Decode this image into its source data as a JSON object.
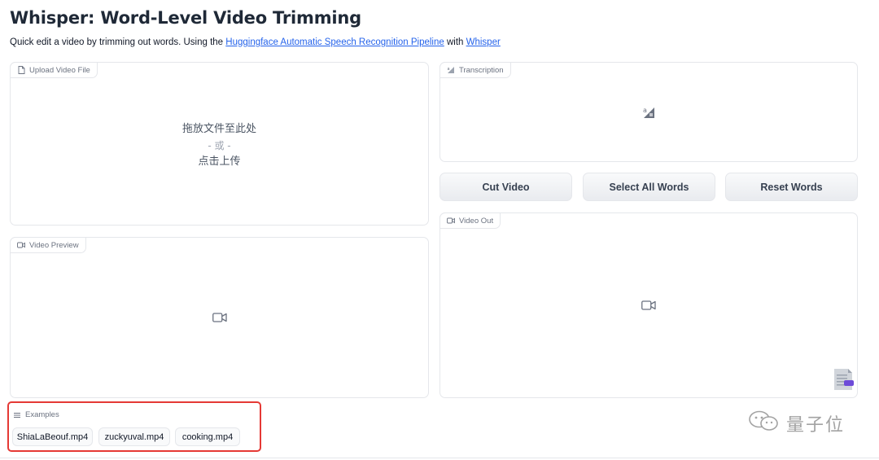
{
  "page": {
    "title": "Whisper: Word-Level Video Trimming",
    "description_prefix": "Quick edit a video by trimming out words. Using the ",
    "link_pipeline": "Huggingface Automatic Speech Recognition Pipeline",
    "description_mid": " with ",
    "link_whisper": "Whisper"
  },
  "upload": {
    "label": "Upload Video File",
    "drop_text": "拖放文件至此处",
    "or_text": "- 或 -",
    "click_text": "点击上传"
  },
  "transcription": {
    "label": "Transcription"
  },
  "buttons": {
    "cut": "Cut Video",
    "select_all": "Select All Words",
    "reset": "Reset Words"
  },
  "video_preview": {
    "label": "Video Preview"
  },
  "video_out": {
    "label": "Video Out"
  },
  "examples": {
    "label": "Examples",
    "items": [
      "ShiaLaBeouf.mp4",
      "zuckyuval.mp4",
      "cooking.mp4"
    ]
  },
  "watermark": {
    "text": "量子位"
  },
  "icons": {
    "file": "file-icon",
    "transcription": "text-image-icon",
    "video": "video-camera-icon",
    "examples": "list-icon",
    "doc": "document-badge-icon",
    "wechat": "wechat-icon"
  },
  "colors": {
    "link": "#2563eb",
    "highlight_border": "#e53935",
    "doc_badge_accent": "#6d4bd8"
  }
}
